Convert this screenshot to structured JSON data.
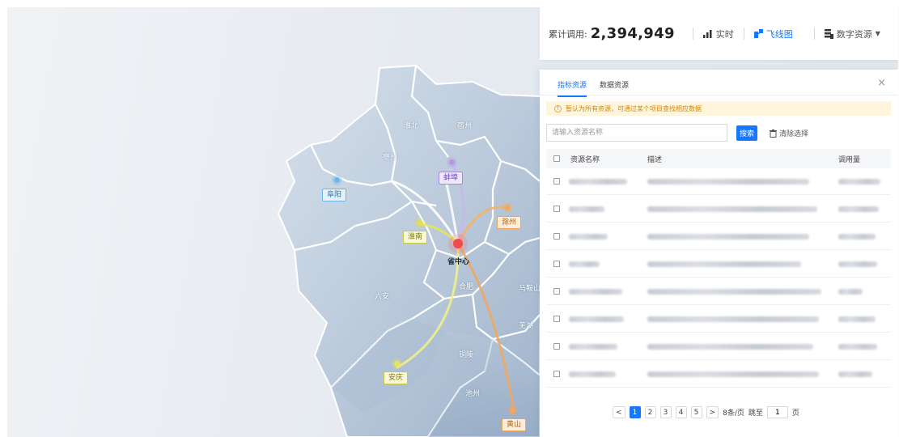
{
  "topbar": {
    "cumulative_label": "累计调用:",
    "cumulative_value": "2,394,949",
    "realtime_label": "实时",
    "flightmap_label": "飞线图",
    "digital_label": "数字资源"
  },
  "panel": {
    "tabs": [
      {
        "label": "指标资源",
        "active": true
      },
      {
        "label": "数据资源",
        "active": false
      }
    ],
    "close_icon": "×",
    "notice": "暂认为所有资源，可通过某个项目查找相应数据",
    "search": {
      "placeholder": "请输入资源名称",
      "value": ""
    },
    "search_button": "搜索",
    "clear_label": "清除选择",
    "columns": [
      "资源名称",
      "描述",
      "调用量"
    ],
    "row_count": 8,
    "pagination": {
      "prev": "<",
      "pages": [
        "1",
        "2",
        "3",
        "4",
        "5"
      ],
      "current": "1",
      "next": ">",
      "page_size": "8条/页",
      "jump_label": "跳至",
      "jump_value": "1",
      "page_suffix": "页"
    }
  },
  "map": {
    "regions": [
      "淮北",
      "宿州",
      "亳州",
      "六安",
      "合肥",
      "马鞍山",
      "芜湖",
      "铜陵",
      "池州"
    ],
    "tagged_cities": [
      "阜阳",
      "蚌埠",
      "淮南",
      "滁州",
      "安庆",
      "黄山"
    ],
    "center_label": "省中心"
  },
  "colors": {
    "accent": "#1677ff",
    "notice_bg": "#fff4dc",
    "map_fill": "#c7d4e3"
  }
}
